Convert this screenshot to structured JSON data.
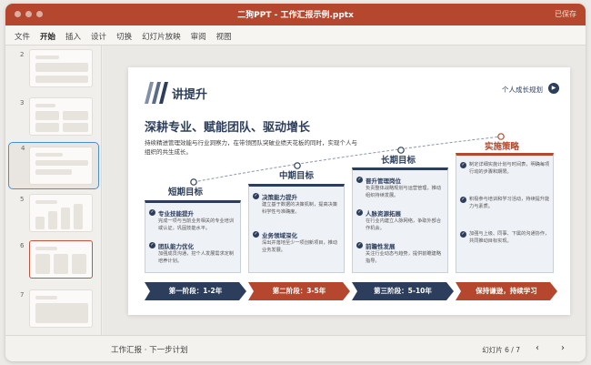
{
  "window": {
    "title": "二狗PPT - 工作汇报示例.pptx",
    "saved_status": "已保存"
  },
  "ribbon": {
    "tabs": [
      "文件",
      "开始",
      "插入",
      "设计",
      "切换",
      "幻灯片放映",
      "审阅",
      "视图"
    ],
    "active_tab": "开始"
  },
  "sidebar": {
    "slide_numbers": [
      "2",
      "3",
      "4",
      "5",
      "6",
      "7"
    ],
    "selected": "4"
  },
  "slide": {
    "heading": "讲提升",
    "growth_link": "个人成长规划",
    "title": "深耕专业、赋能团队、驱动增长",
    "intro": "持续精进管理效能与行业洞察力，在带领团队突破业绩天花板的同时，实现个人与组织的共生成长。",
    "stages": [
      {
        "label": "短期目标",
        "items": [
          {
            "title": "专业技能提升",
            "desc": "完成一项与当前业务相关的专业培训或认证，巩固技能水平。"
          },
          {
            "title": "团队能力优化",
            "desc": "加强成员沟通，挖个人发展需求定制培养计划。"
          }
        ]
      },
      {
        "label": "中期目标",
        "items": [
          {
            "title": "决策能力提升",
            "desc": "建立基于数据的决策机制，提高决策科学性与准确度。"
          },
          {
            "title": "业务领域深化",
            "desc": "深出并落地至少一项创新项目，推动业务发展。"
          }
        ]
      },
      {
        "label": "长期目标",
        "items": [
          {
            "title": "晋升管理岗位",
            "desc": "负责整体战略规划与运营管理，推动组织持续发展。"
          },
          {
            "title": "人脉资源拓展",
            "desc": "在行业内建立人脉网络，争取外部合作机会。"
          },
          {
            "title": "前瞻性发展",
            "desc": "关注行业动态与趋势，提供前瞻建略指导。"
          }
        ]
      },
      {
        "label": "实施策略",
        "items": [
          {
            "title": "",
            "desc": "制定详细实施计划与时间表，明确每项行动的步骤和期限。"
          },
          {
            "title": "",
            "desc": "积极参与培训和学习活动，持续提升能力与素质。"
          },
          {
            "title": "",
            "desc": "加强与上级、同事、下属的沟通协作，共同推动目标实现。"
          }
        ]
      }
    ],
    "phases": [
      "第一阶段：1-2年",
      "第二阶段：3-5年",
      "第三阶段：5-10年",
      "保持谦逊，持续学习"
    ]
  },
  "statusbar": {
    "breadcrumb": "工作汇报 · 下一步计划",
    "slide_counter": "幻灯片 6 / 7",
    "prev_icon": "chevron-left-icon",
    "next_icon": "chevron-right-icon"
  },
  "colors": {
    "brand": "#b5472e",
    "navy": "#2c3e5c"
  }
}
